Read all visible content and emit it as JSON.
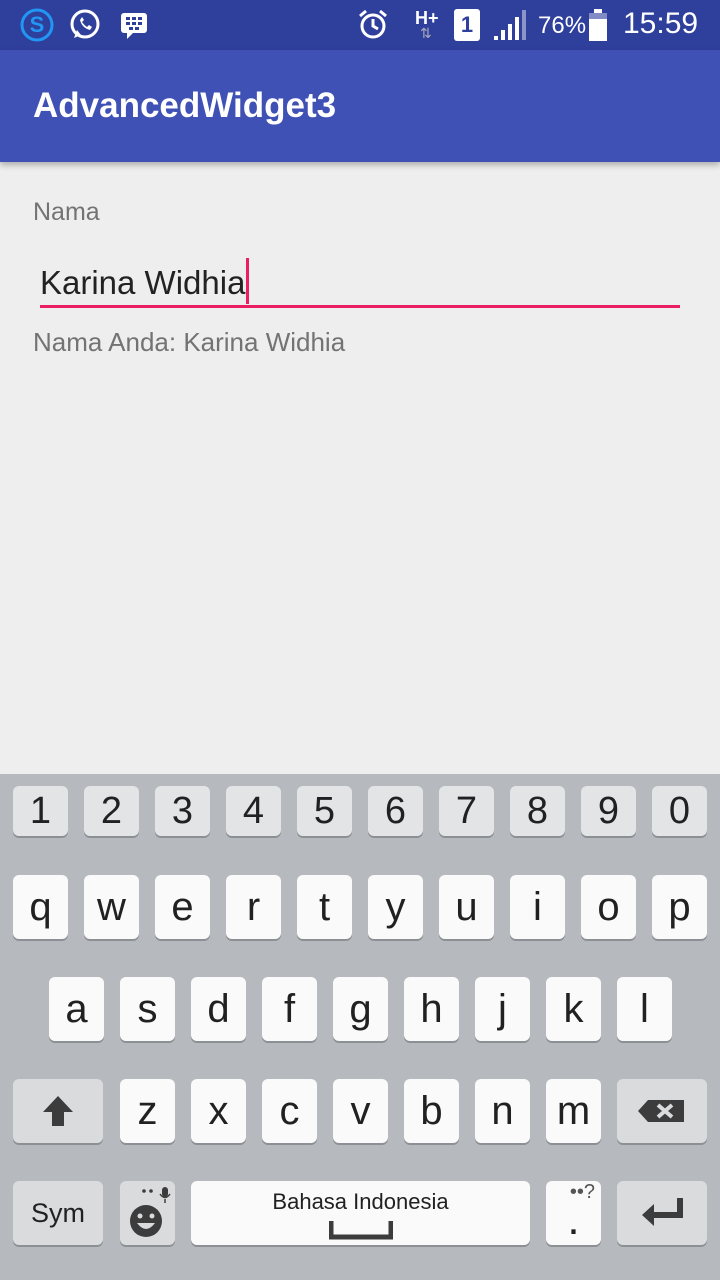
{
  "status_bar": {
    "battery_percent": "76%",
    "time": "15:59",
    "network_type": "H+",
    "sim_slot": "1",
    "icons": [
      "skype-icon",
      "whatsapp-icon",
      "blackberry-messenger-icon",
      "alarm-icon",
      "network-hplus-icon",
      "sim-1-icon",
      "signal-icon",
      "battery-icon"
    ]
  },
  "app": {
    "title": "AdvancedWidget3",
    "colors": {
      "primary": "#3f51b5",
      "primary_dark": "#2f3f9c",
      "accent": "#e91e63",
      "background": "#eeeeee"
    }
  },
  "form": {
    "label": "Nama",
    "input_value": "Karina Widhia",
    "output_text": "Nama Anda: Karina Widhia"
  },
  "keyboard": {
    "number_row": [
      "1",
      "2",
      "3",
      "4",
      "5",
      "6",
      "7",
      "8",
      "9",
      "0"
    ],
    "row1": [
      "q",
      "w",
      "e",
      "r",
      "t",
      "y",
      "u",
      "i",
      "o",
      "p"
    ],
    "row2": [
      "a",
      "s",
      "d",
      "f",
      "g",
      "h",
      "j",
      "k",
      "l"
    ],
    "row3": [
      "z",
      "x",
      "c",
      "v",
      "b",
      "n",
      "m"
    ],
    "sym_label": "Sym",
    "space_label": "Bahasa Indonesia",
    "period_label": ".",
    "punct_hint": "••?",
    "icons": {
      "shift": "shift-arrow-icon",
      "backspace": "backspace-icon",
      "emoji": "emoji-icon",
      "mic": "microphone-icon",
      "enter": "enter-icon"
    }
  }
}
